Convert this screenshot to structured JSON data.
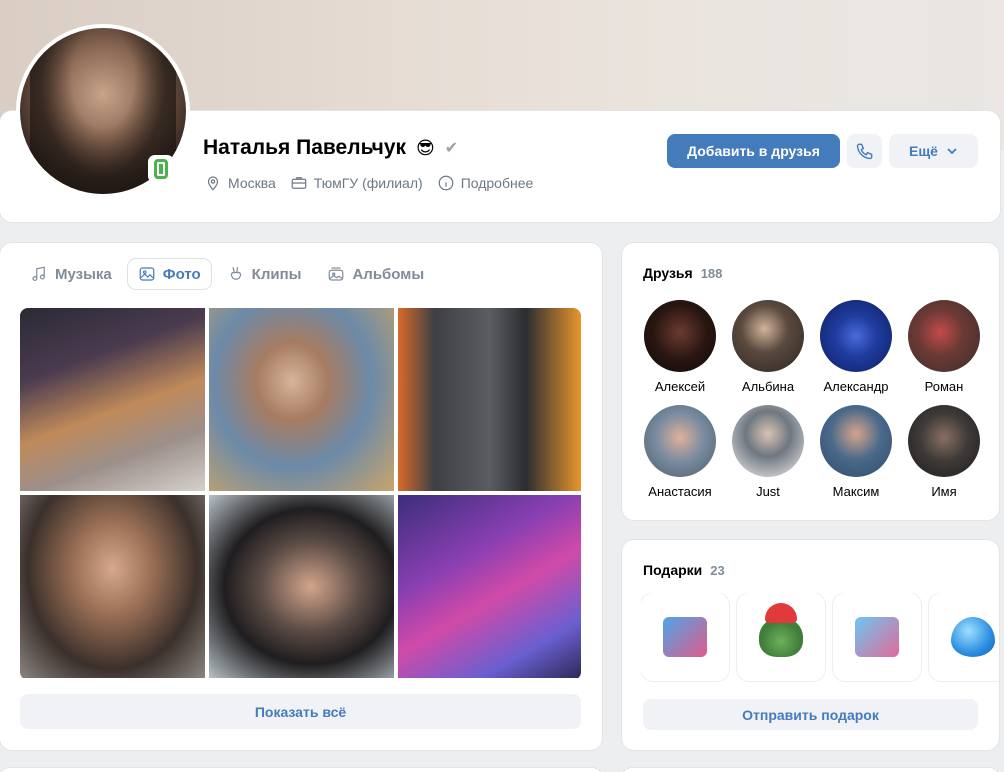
{
  "profile": {
    "name": "Наталья Павельчук",
    "emoji": "😎",
    "verified_mark": "✔",
    "city": "Москва",
    "education": "ТюмГУ (филиал)",
    "details_link": "Подробнее"
  },
  "actions": {
    "add_friend": "Добавить в друзья",
    "more": "Ещё"
  },
  "tabs": [
    {
      "label": "Музыка",
      "icon": "music-icon",
      "active": false
    },
    {
      "label": "Фото",
      "icon": "photo-icon",
      "active": true
    },
    {
      "label": "Клипы",
      "icon": "clips-icon",
      "active": false
    },
    {
      "label": "Альбомы",
      "icon": "albums-icon",
      "active": false
    }
  ],
  "photos": {
    "show_all": "Показать всё"
  },
  "friends": {
    "title": "Друзья",
    "count": "188",
    "items": [
      {
        "name": "Алексей"
      },
      {
        "name": "Альбина"
      },
      {
        "name": "Александр"
      },
      {
        "name": "Роман"
      },
      {
        "name": "Анастасия"
      },
      {
        "name": "Just"
      },
      {
        "name": "Максим"
      },
      {
        "name": "Имя"
      }
    ]
  },
  "gifts": {
    "title": "Подарки",
    "count": "23",
    "send": "Отправить подарок"
  },
  "colors": {
    "accent": "#447bba",
    "online": "#4bb34b",
    "secondary_text": "#818c99"
  }
}
